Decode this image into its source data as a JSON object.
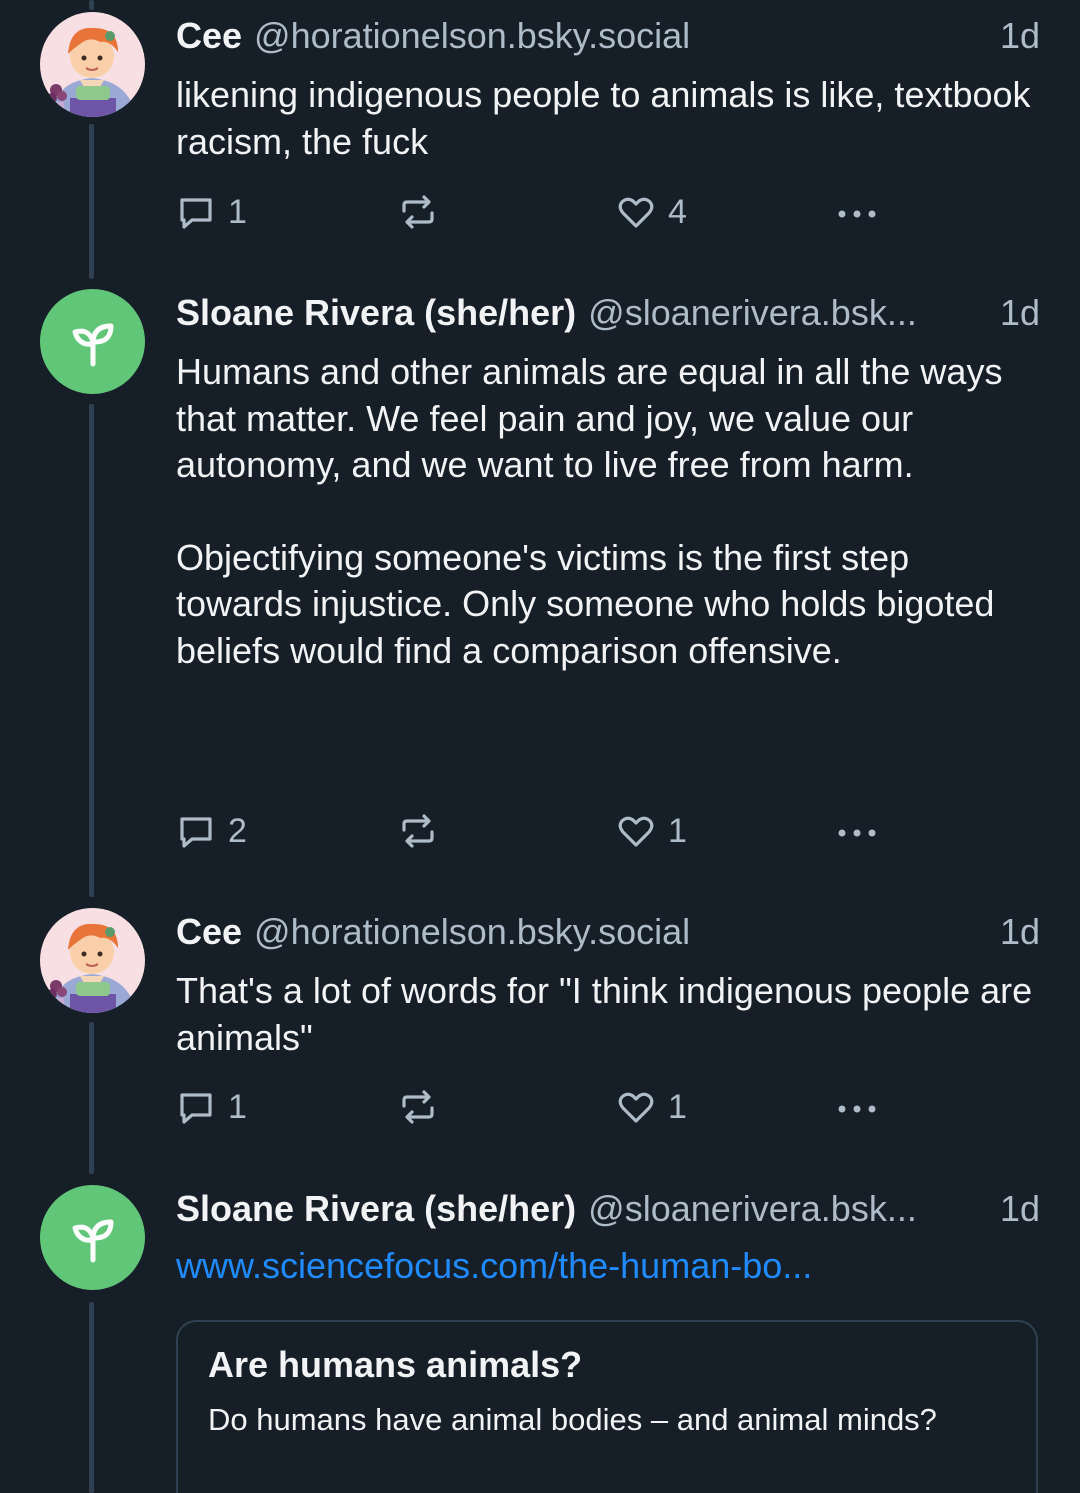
{
  "colors": {
    "background": "#161e27",
    "text": "#f1f3f5",
    "muted": "#aebbc9",
    "link": "#208bfe",
    "thread_line": "#2e4052",
    "avatar_green": "#62c678"
  },
  "posts": [
    {
      "display_name": "Cee",
      "handle": "@horationelson.bsky.social",
      "time": "1d",
      "avatar": "cartoon-portrait-avatar",
      "text": [
        "likening indigenous people to animals is like, textbook racism, the fuck"
      ],
      "replies": "1",
      "reposts": "",
      "likes": "4"
    },
    {
      "display_name": "Sloane Rivera (she/her)",
      "handle": "@sloanerivera.bsk...",
      "time": "1d",
      "avatar": "sprout-icon",
      "text": [
        "Humans and other animals are equal in all the ways that matter. We feel pain and joy, we value our autonomy, and we want to live free from harm.",
        "Objectifying someone's victims is the first step towards injustice. Only someone who holds bigoted beliefs would find a comparison offensive."
      ],
      "replies": "2",
      "reposts": "",
      "likes": "1"
    },
    {
      "display_name": "Cee",
      "handle": "@horationelson.bsky.social",
      "time": "1d",
      "avatar": "cartoon-portrait-avatar",
      "text": [
        "That's a lot of words for \"I think indigenous people are animals\""
      ],
      "replies": "1",
      "reposts": "",
      "likes": "1"
    },
    {
      "display_name": "Sloane Rivera (she/her)",
      "handle": "@sloanerivera.bsk...",
      "time": "1d",
      "avatar": "sprout-icon",
      "link": "www.sciencefocus.com/the-human-bo...",
      "card": {
        "title": "Are humans animals?",
        "description": "Do humans have animal bodies – and animal minds?"
      }
    }
  ]
}
